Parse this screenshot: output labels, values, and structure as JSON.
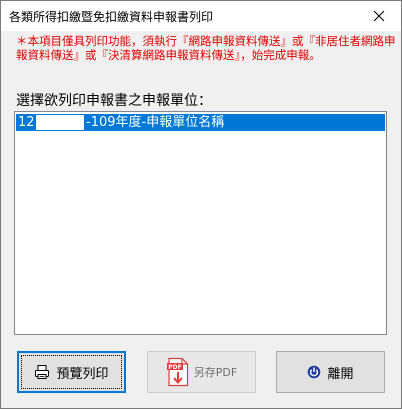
{
  "window": {
    "title": "各類所得扣繳暨免扣繳資料申報書列印",
    "close_symbol": "✕"
  },
  "notice": {
    "text": "＊本項目僅具列印功能，須執行『網路申報資料傳送』或『非居住者網路申報資料傳送』或『決清算網路申報資料傳送』，始完成申報。",
    "color": "#e00000"
  },
  "selection": {
    "prompt": "選擇欲列印申報書之申報單位：",
    "items": [
      {
        "code": "12",
        "rest": "-109年度-申報單位名稱",
        "selected": true
      }
    ],
    "highlight_color": "#0078d7"
  },
  "buttons": {
    "print_preview": {
      "label": "預覽列印",
      "icon": "printer-icon",
      "enabled": true
    },
    "save_pdf": {
      "label": "另存PDF",
      "icon": "pdf-file-icon",
      "icon_text": "PDF",
      "enabled": false
    },
    "exit": {
      "label": "離開",
      "icon": "exit-icon",
      "enabled": true
    }
  }
}
